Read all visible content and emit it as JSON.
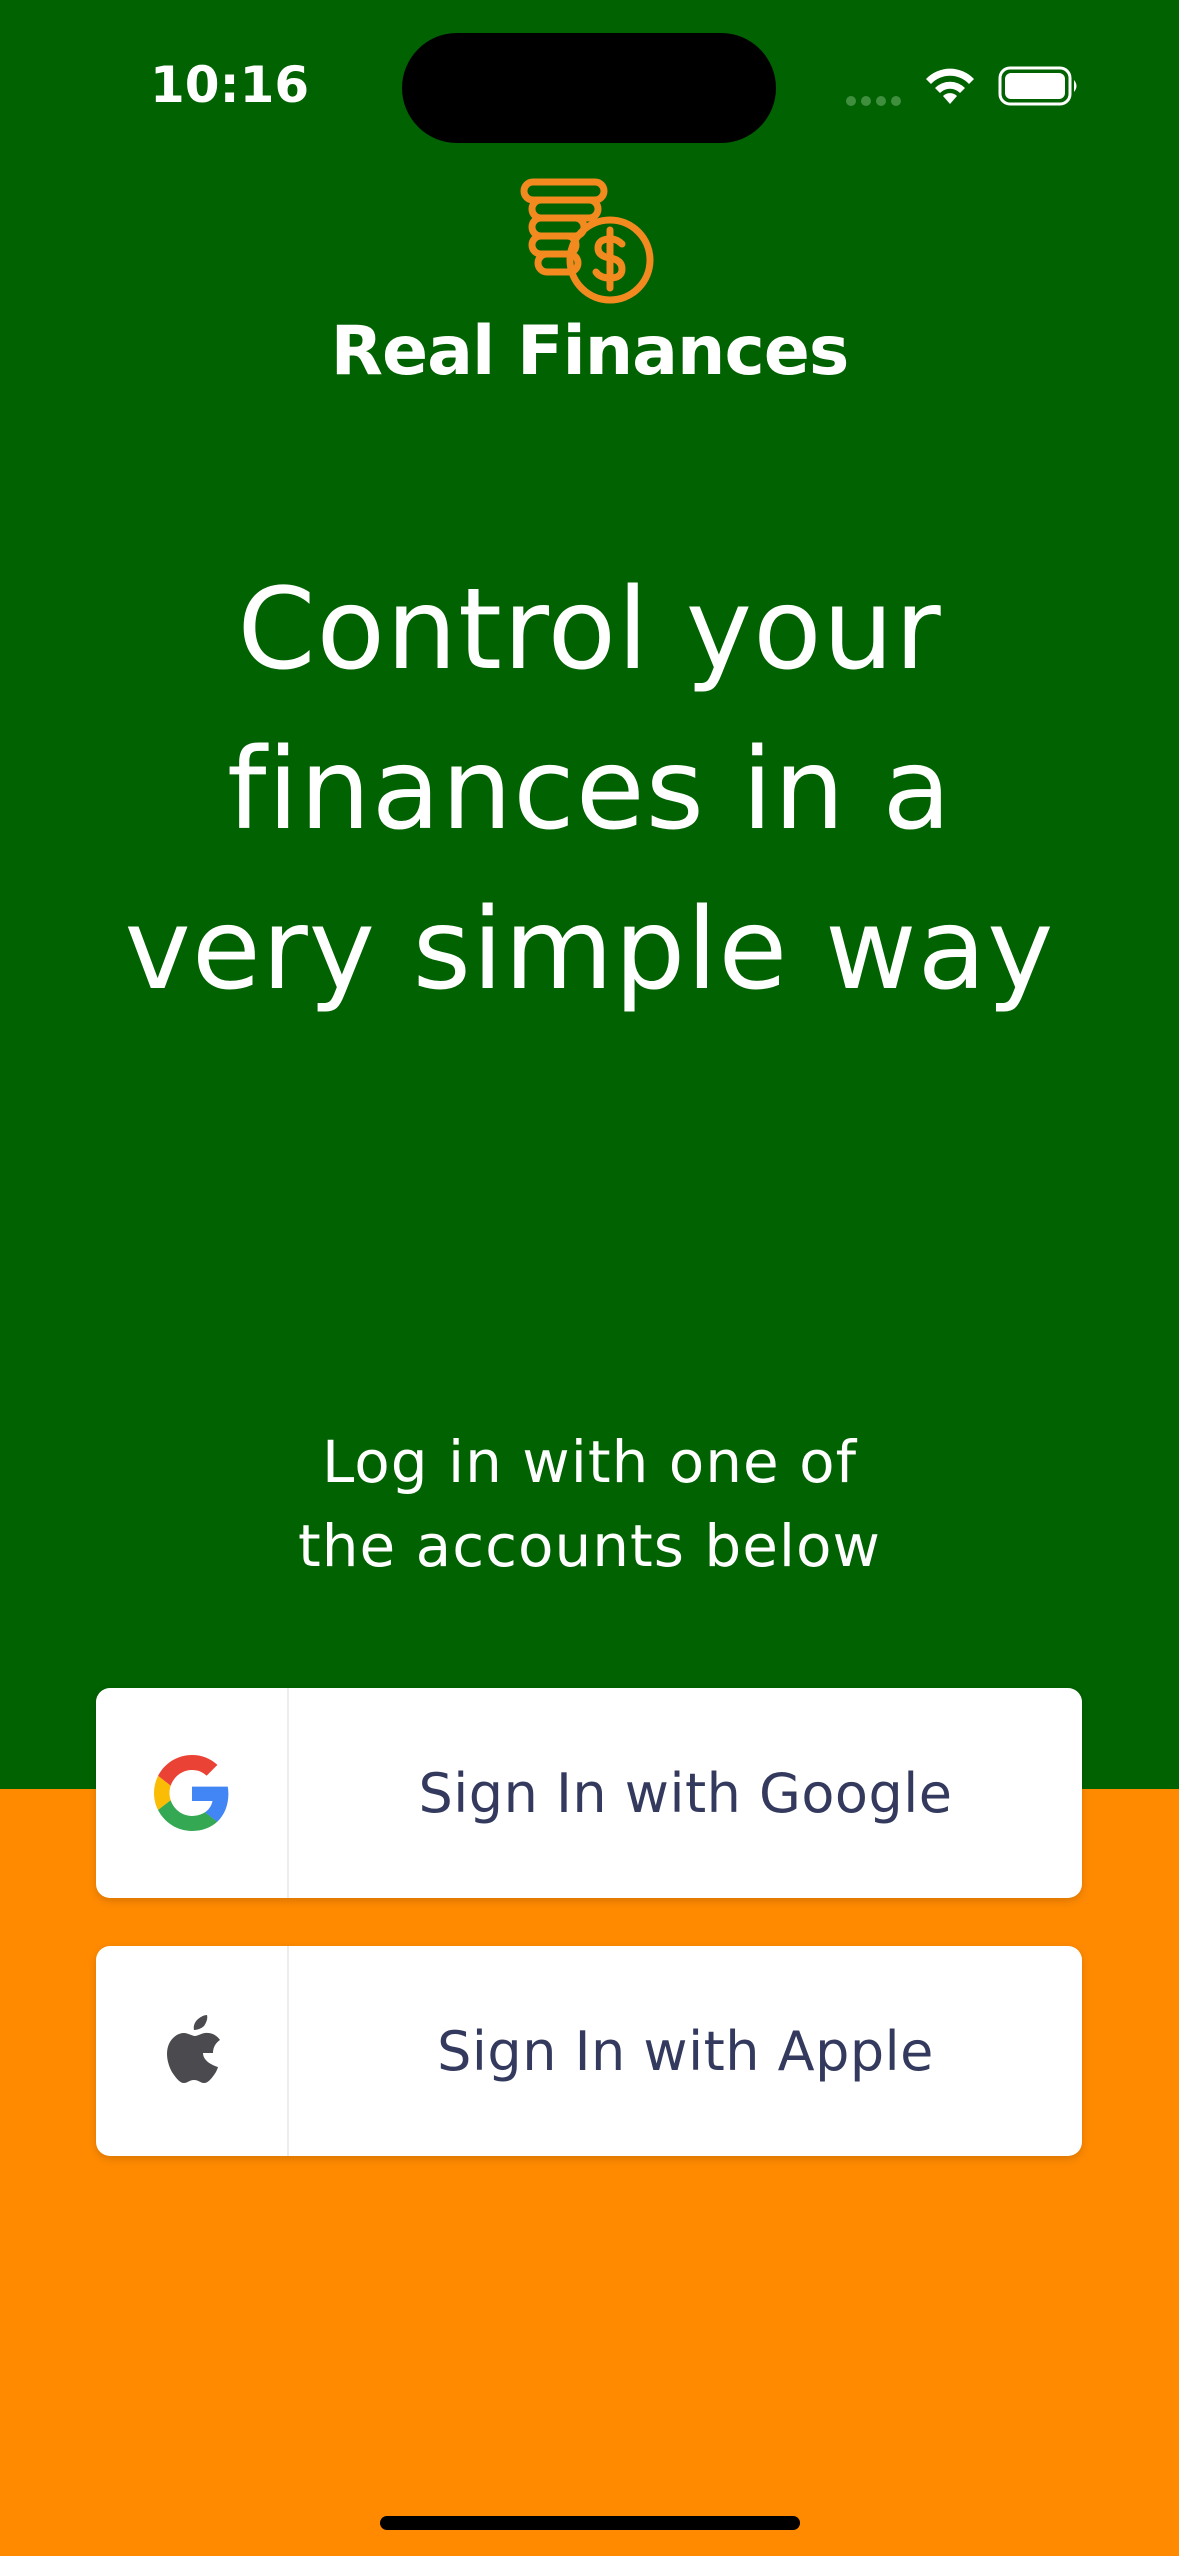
{
  "status_bar": {
    "time": "10:16"
  },
  "brand": {
    "app_name": "Real Finances",
    "logo_icon": "coins-dollar-icon",
    "logo_color": "#F28A20"
  },
  "hero": {
    "headline_lines": [
      "Control your",
      "finances in a",
      "very simple way"
    ]
  },
  "login": {
    "subtitle_lines": [
      "Log in with one of",
      "the accounts below"
    ]
  },
  "buttons": {
    "google": {
      "label": "Sign In with Google",
      "icon": "google-icon"
    },
    "apple": {
      "label": "Sign In with Apple",
      "icon": "apple-icon"
    }
  },
  "colors": {
    "top_background": "#006200",
    "bottom_background": "#FF8A00",
    "button_text": "#343A5E"
  }
}
